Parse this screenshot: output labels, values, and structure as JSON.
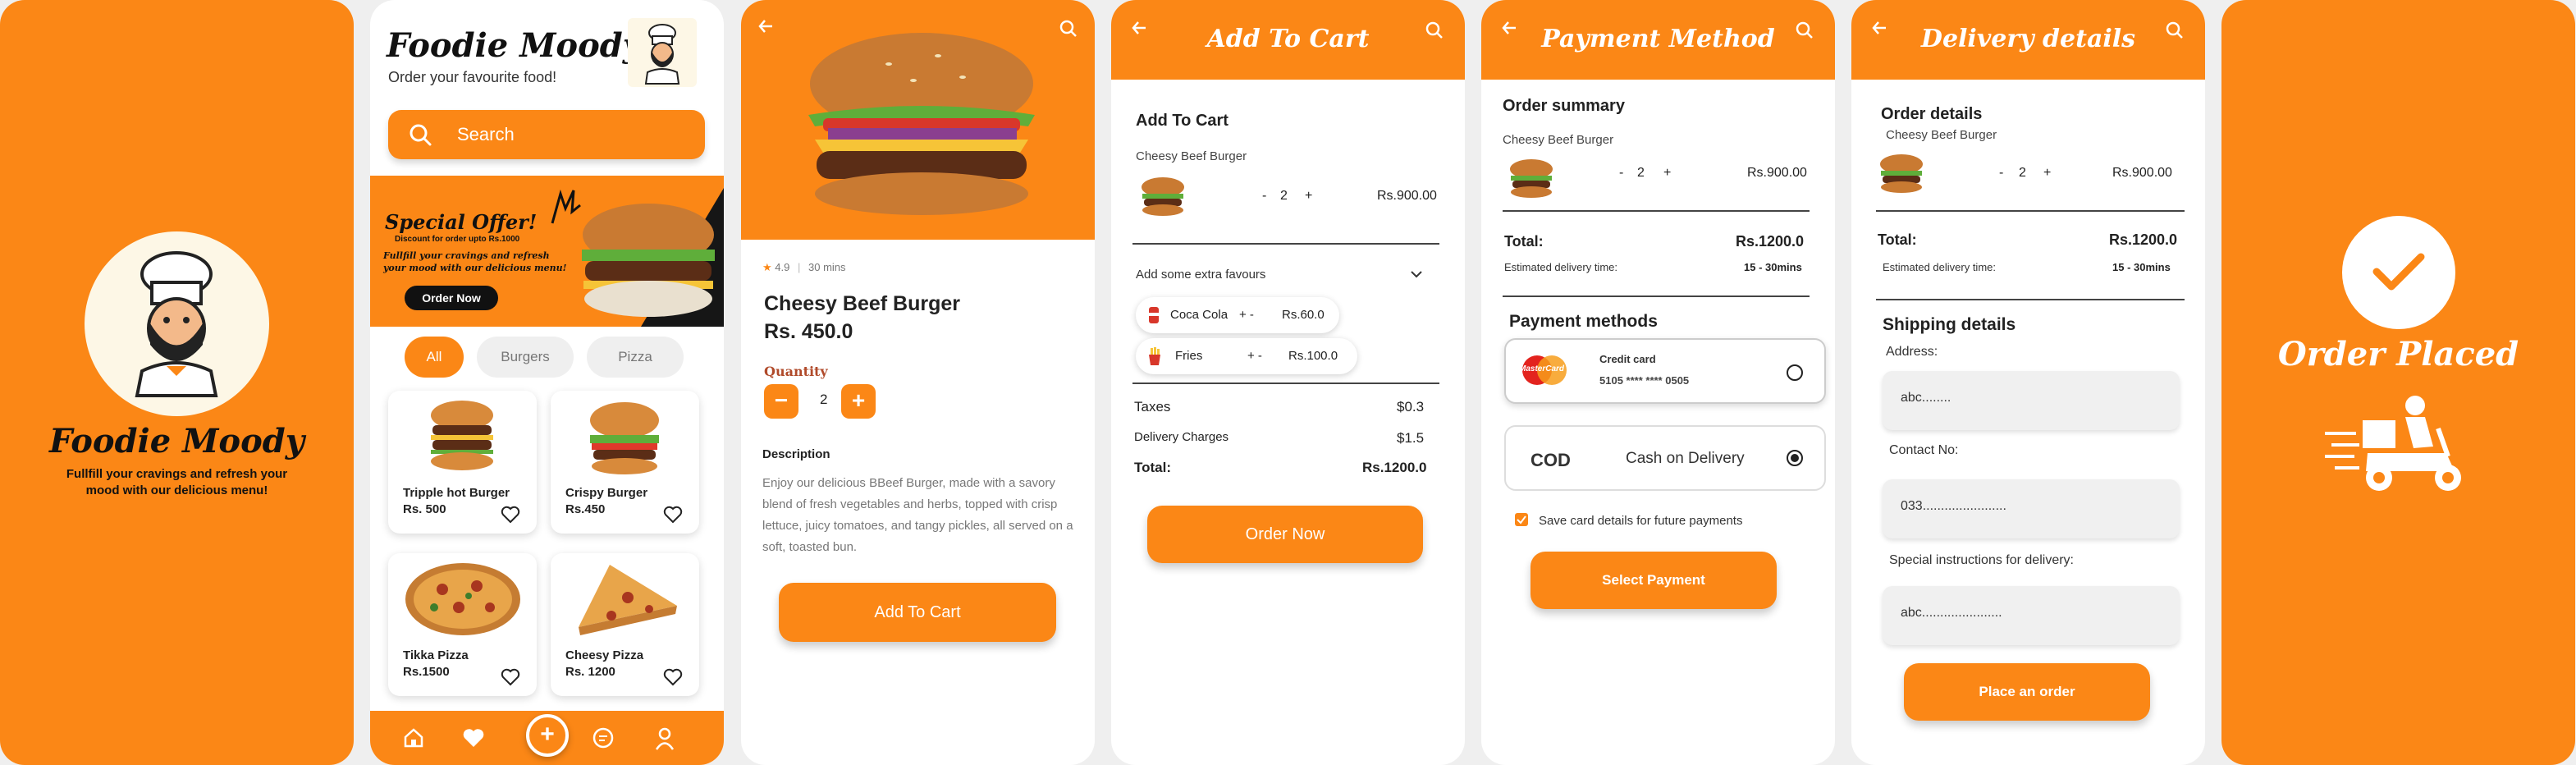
{
  "colors": {
    "accent": "#fb8716",
    "dark": "#161616",
    "card": "#ffffff"
  },
  "splash": {
    "brand": "Foodie Moody",
    "tagline": "Fullfill your cravings and refresh your mood with our delicious menu!"
  },
  "home": {
    "title": "Foodie Moody",
    "subtitle": "Order your favourite food!",
    "search_label": "Search",
    "banner": {
      "title": "Special Offer!",
      "small": "Discount for order upto Rs.1000",
      "text": "Fullfill your cravings and refresh your mood with our delicious menu!",
      "button": "Order Now"
    },
    "chips": [
      "All",
      "Burgers",
      "Pizza"
    ],
    "items": [
      {
        "name": "Tripple hot Burger",
        "price": "Rs. 500"
      },
      {
        "name": "Crispy Burger",
        "price": "Rs.450"
      },
      {
        "name": "Tikka Pizza",
        "price": "Rs.1500"
      },
      {
        "name": "Cheesy Pizza",
        "price": "Rs. 1200"
      }
    ],
    "nav_icons": [
      "home-icon",
      "heart-icon",
      "plus-icon",
      "chat-icon",
      "user-icon"
    ],
    "fab": "+"
  },
  "detail": {
    "rating": "4.9",
    "time": "30 mins",
    "name": "Cheesy Beef Burger",
    "price": "Rs. 450.0",
    "quantity_label": "Quantity",
    "minus": "−",
    "plus": "+",
    "quantity": "2",
    "description_label": "Description",
    "description": "Enjoy our delicious BBeef Burger, made with a savory blend of fresh vegetables and herbs, topped with crisp lettuce, juicy tomatoes, and tangy pickles, all served on a soft, toasted bun.",
    "cta": "Add To Cart"
  },
  "cart": {
    "header": "Add To Cart",
    "section_title": "Add To Cart",
    "item_name": "Cheesy Beef Burger",
    "minus": "-",
    "qty": "2",
    "plus": "+",
    "item_price": "Rs.900.00",
    "extras_label": "Add some extra favours",
    "extras": [
      {
        "name": "Coca Cola",
        "ctrl": "+  -",
        "price": "Rs.60.0"
      },
      {
        "name": "Fries",
        "ctrl": "+  -",
        "price": "Rs.100.0"
      }
    ],
    "taxes_label": "Taxes",
    "taxes": "$0.3",
    "delivery_label": "Delivery Charges",
    "delivery": "$1.5",
    "total_label": "Total:",
    "total": "Rs.1200.0",
    "cta": "Order Now"
  },
  "payment": {
    "header": "Payment Method",
    "summary_title": "Order summary",
    "item_name": "Cheesy Beef Burger",
    "minus": "-",
    "qty": "2",
    "plus": "+",
    "item_price": "Rs.900.00",
    "total_label": "Total:",
    "total": "Rs.1200.0",
    "eta_label": "Estimated delivery time:",
    "eta": "15 - 30mins",
    "methods_title": "Payment methods",
    "card_brand": "MasterCard",
    "card_label": "Credit card",
    "card_number": "5105 **** **** 0505",
    "cod_code": "COD",
    "cod_label": "Cash on Delivery",
    "save_label": "Save card details for future payments",
    "cta": "Select Payment"
  },
  "delivery": {
    "header": "Delivery details",
    "order_title": "Order  details",
    "item_name": "Cheesy Beef Burger",
    "minus": "-",
    "qty": "2",
    "plus": "+",
    "item_price": "Rs.900.00",
    "total_label": "Total:",
    "total": "Rs.1200.0",
    "eta_label": "Estimated delivery time:",
    "eta": "15 - 30mins",
    "shipping_title": "Shipping details",
    "address_label": "Address:",
    "address_value": "abc........",
    "contact_label": "Contact No:",
    "contact_value": "033.......................",
    "instructions_label": "Special instructions for delivery:",
    "instructions_value": "abc......................",
    "cta": "Place an order"
  },
  "placed": {
    "title": "Order Placed"
  }
}
